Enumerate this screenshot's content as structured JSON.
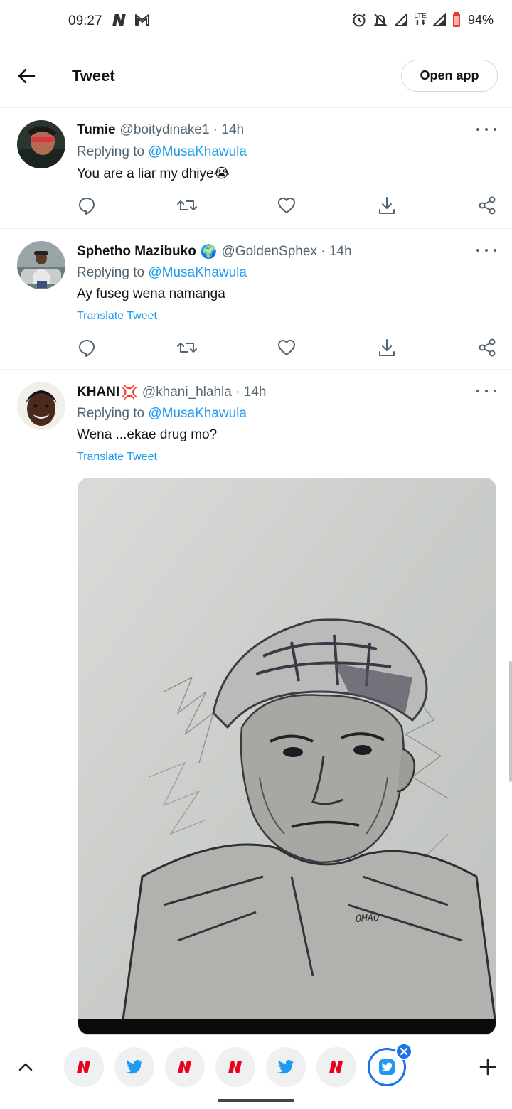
{
  "status_bar": {
    "time": "09:27",
    "left_icons": [
      "news-icon",
      "gmail-icon"
    ],
    "right_icons": [
      "alarm-icon",
      "mute-icon",
      "signal-icon",
      "lte-icon",
      "signal-icon",
      "battery-icon"
    ],
    "network_label": "LTE",
    "battery": "94%"
  },
  "header": {
    "title": "Tweet",
    "open_app_label": "Open app"
  },
  "tweets": [
    {
      "name": "Tumie",
      "handle": "@boitydinake1 · 14h",
      "replying_prefix": "Replying to",
      "replying_to": "@MusaKhawula",
      "text": "You are a liar my dhiye😭",
      "translate": ""
    },
    {
      "name": "Sphetho Mazibuko",
      "name_emoji": "🌍",
      "handle": "@GoldenSphex · 14h",
      "replying_prefix": "Replying to",
      "replying_to": "@MusaKhawula",
      "text": "Ay fuseg wena namanga",
      "translate": "Translate Tweet"
    },
    {
      "name": "KHANI",
      "name_emoji": "💢",
      "handle": "@khani_hlahla · 14h",
      "replying_prefix": "Replying to",
      "replying_to": "@MusaKhawula",
      "text": "Wena ...ekae drug mo?",
      "translate": "Translate Tweet",
      "media_signature": "OMAO"
    }
  ],
  "action_icons": [
    "reply-icon",
    "retweet-icon",
    "like-icon",
    "share-download-icon",
    "share-icon"
  ],
  "browser_bar": {
    "tabs": [
      "news-tab",
      "twitter-tab",
      "news-tab",
      "news-tab",
      "twitter-tab",
      "news-tab",
      "twitter-tab-active"
    ],
    "new_tab_icon": "plus-icon",
    "up_icon": "chevron-up-icon"
  },
  "colors": {
    "accent": "#1d9bf0",
    "secondary_text": "#536471",
    "news_red": "#e8001c",
    "browser_blue": "#1a73e8"
  }
}
